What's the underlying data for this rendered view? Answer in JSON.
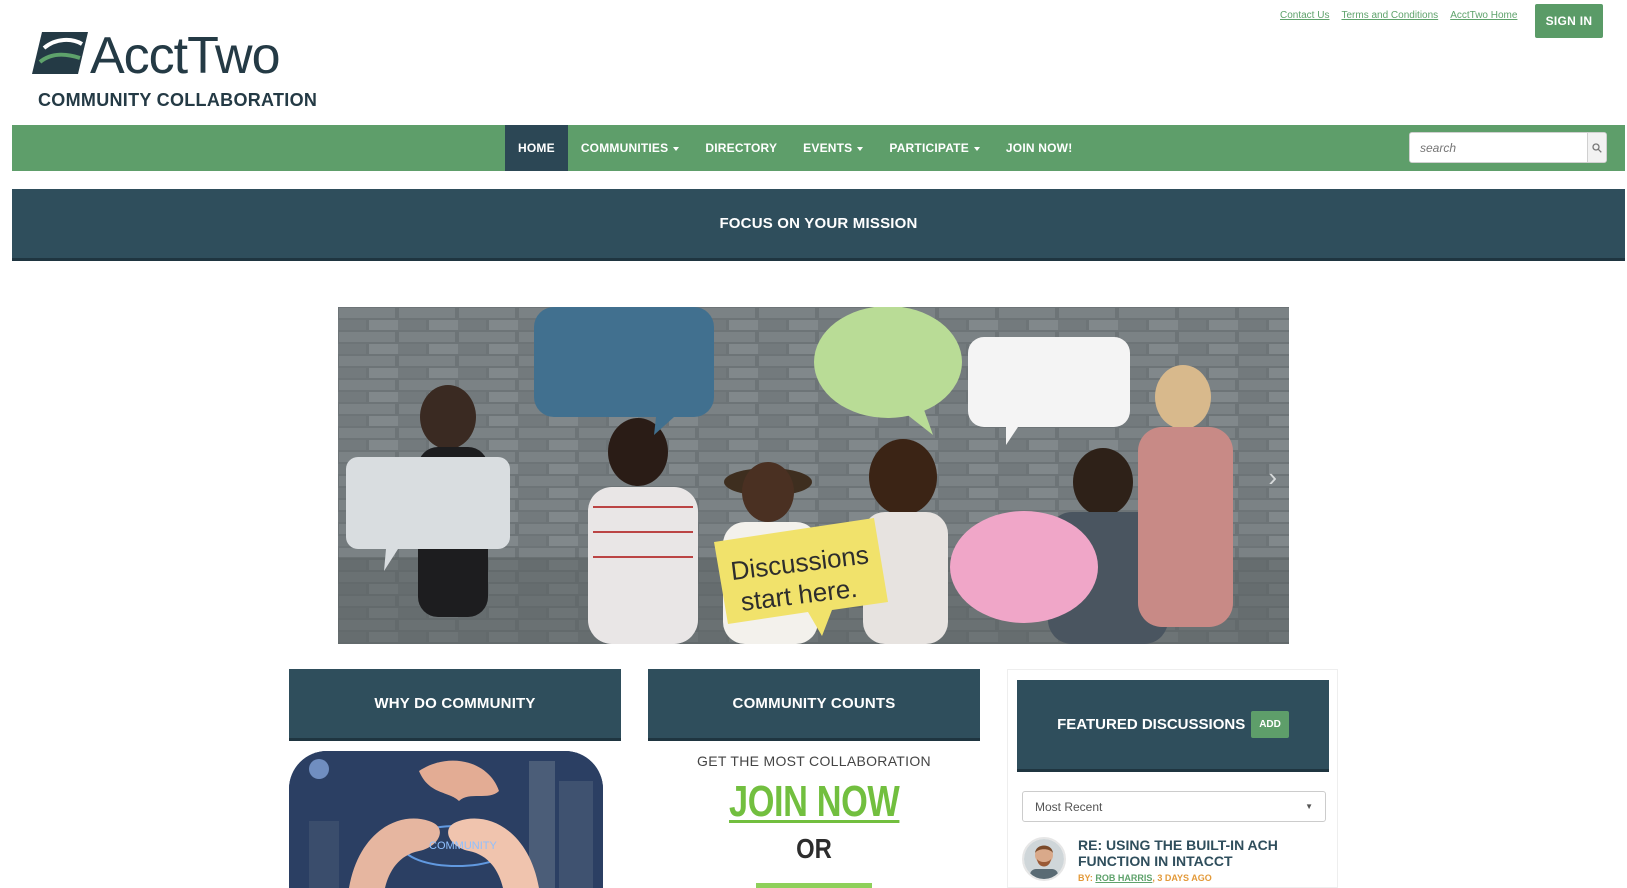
{
  "header": {
    "top_links": [
      "Contact Us",
      "Terms and Conditions",
      "AcctTwo Home"
    ],
    "sign_in_label": "SIGN IN",
    "logo_text": "AcctTwo",
    "logo_sub": "COMMUNITY COLLABORATION"
  },
  "nav": {
    "items": [
      {
        "label": "HOME",
        "active": true,
        "dropdown": false
      },
      {
        "label": "COMMUNITIES",
        "active": false,
        "dropdown": true
      },
      {
        "label": "DIRECTORY",
        "active": false,
        "dropdown": false
      },
      {
        "label": "EVENTS",
        "active": false,
        "dropdown": true
      },
      {
        "label": "PARTICIPATE",
        "active": false,
        "dropdown": true
      },
      {
        "label": "JOIN NOW!",
        "active": false,
        "dropdown": false
      }
    ],
    "search_placeholder": "search"
  },
  "banner": {
    "title": "FOCUS ON YOUR MISSION"
  },
  "hero": {
    "sign_line1": "Discussions",
    "sign_line2": "start here."
  },
  "why": {
    "title": "WHY DO COMMUNITY",
    "image_word": "COMMUNITY"
  },
  "counts": {
    "title": "COMMUNITY COUNTS",
    "sub": "GET THE MOST COLLABORATION",
    "join_label": "JOIN NOW",
    "or_label": "OR"
  },
  "featured": {
    "title": "FEATURED DISCUSSIONS",
    "add_label": "ADD",
    "sort_value": "Most Recent",
    "item": {
      "title": "RE: USING THE BUILT-IN ACH FUNCTION IN INTACCT",
      "by_label": "BY:",
      "author": "ROB HARRIS",
      "time": ", 3 DAYS AGO"
    }
  },
  "colors": {
    "nav_green": "#5e9e6a",
    "dark_teal": "#2f4e5c",
    "link_green": "#5ea26b",
    "join_green": "#72bf3f"
  }
}
